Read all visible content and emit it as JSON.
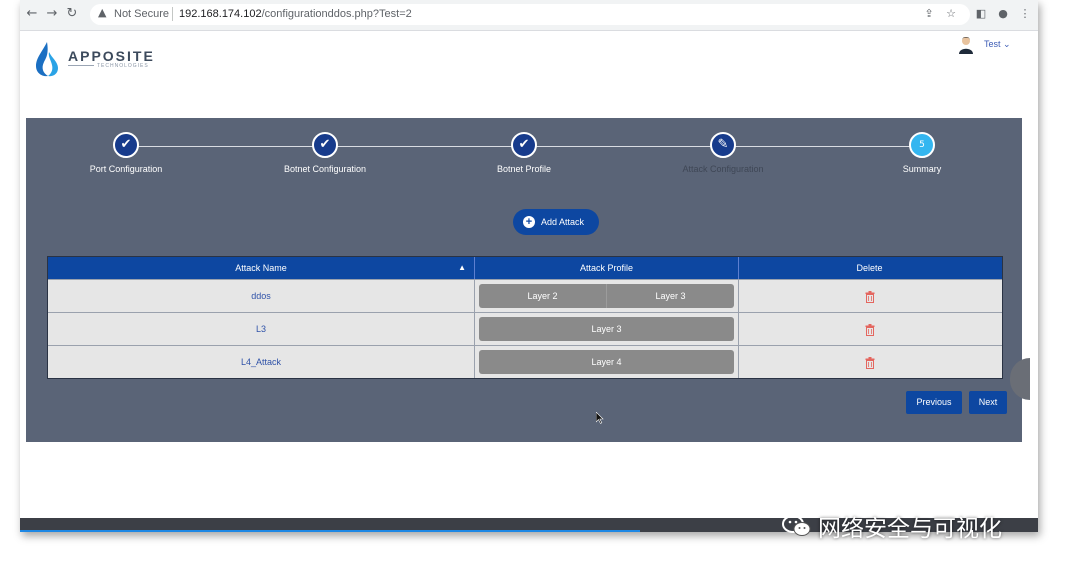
{
  "browser": {
    "security_icon": "warning-triangle-icon",
    "security_label": "Not Secure",
    "url_host": "192.168.174.102",
    "url_path": "/configurationddos.php?Test=2"
  },
  "header": {
    "logo_text": "APPOSITE",
    "logo_sub": "TECHNOLOGIES",
    "user_name": "Test ⌄"
  },
  "wizard": {
    "steps": [
      {
        "label": "Port Configuration",
        "state": "done",
        "icon": "✔"
      },
      {
        "label": "Botnet Configuration",
        "state": "done",
        "icon": "✔"
      },
      {
        "label": "Botnet Profile",
        "state": "done",
        "icon": "✔"
      },
      {
        "label": "Attack Configuration",
        "state": "current",
        "icon": "✎"
      },
      {
        "label": "Summary",
        "state": "future",
        "icon": "5"
      }
    ]
  },
  "add_attack_label": "Add Attack",
  "table": {
    "headers": [
      "Attack Name",
      "Attack Profile",
      "Delete"
    ],
    "sort_indicator": "▲",
    "rows": [
      {
        "name": "ddos",
        "profiles": [
          "Layer 2",
          "Layer 3"
        ]
      },
      {
        "name": "L3",
        "profiles": [
          "Layer 3"
        ]
      },
      {
        "name": "L4_Attack",
        "profiles": [
          "Layer 4"
        ]
      }
    ]
  },
  "nav": {
    "previous": "Previous",
    "next": "Next"
  },
  "watermark": "网络安全与可视化",
  "colors": {
    "panel": "#5a6477",
    "primary": "#0d47a1",
    "delete": "#e4665f",
    "chip": "#8a8a8a"
  }
}
